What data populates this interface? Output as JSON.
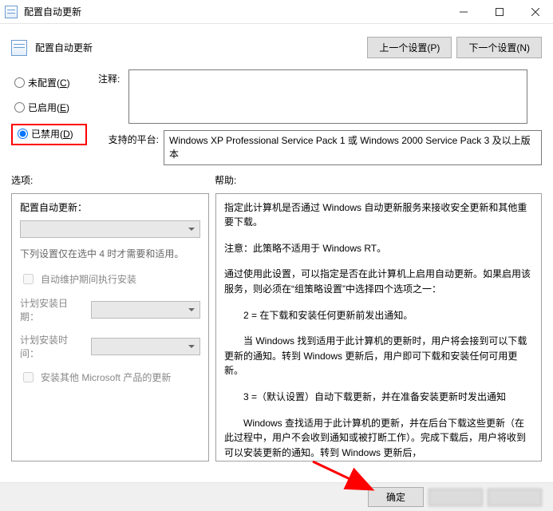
{
  "window": {
    "title": "配置自动更新",
    "heading": "配置自动更新"
  },
  "nav": {
    "prev": "上一个设置(P)",
    "next": "下一个设置(N)"
  },
  "config_radio": {
    "not_configured": "未配置(C)",
    "enabled": "已启用(E)",
    "disabled": "已禁用(D)"
  },
  "labels": {
    "comment": "注释:",
    "platform": "支持的平台:",
    "options": "选项:",
    "help": "帮助:"
  },
  "platform_text": "Windows XP Professional Service Pack 1 或 Windows 2000 Service Pack 3 及以上版本",
  "options_panel": {
    "subhead": "配置自动更新：",
    "desc": "下列设置仅在选中 4 时才需要和适用。",
    "chk_maintenance": "自动维护期间执行安装",
    "schedule_day": "计划安装日期：",
    "schedule_time": "计划安装时间：",
    "chk_other_ms": "安装其他 Microsoft 产品的更新"
  },
  "help_panel": {
    "p1": "指定此计算机是否通过 Windows 自动更新服务来接收安全更新和其他重要下载。",
    "p2": "注意：此策略不适用于 Windows RT。",
    "p3": "通过使用此设置，可以指定是否在此计算机上启用自动更新。如果启用该服务，则必须在“组策略设置”中选择四个选项之一：",
    "p4": "2 = 在下载和安装任何更新前发出通知。",
    "p5": "当 Windows 找到适用于此计算机的更新时，用户将会接到可以下载更新的通知。转到 Windows 更新后，用户即可下载和安装任何可用更新。",
    "p6": "3 =（默认设置）自动下载更新，并在准备安装更新时发出通知",
    "p7": "Windows 查找适用于此计算机的更新，并在后台下载这些更新（在此过程中，用户不会收到通知或被打断工作）。完成下载后，用户将收到可以安装更新的通知。转到 Windows 更新后，"
  },
  "footer": {
    "ok": "确定"
  }
}
